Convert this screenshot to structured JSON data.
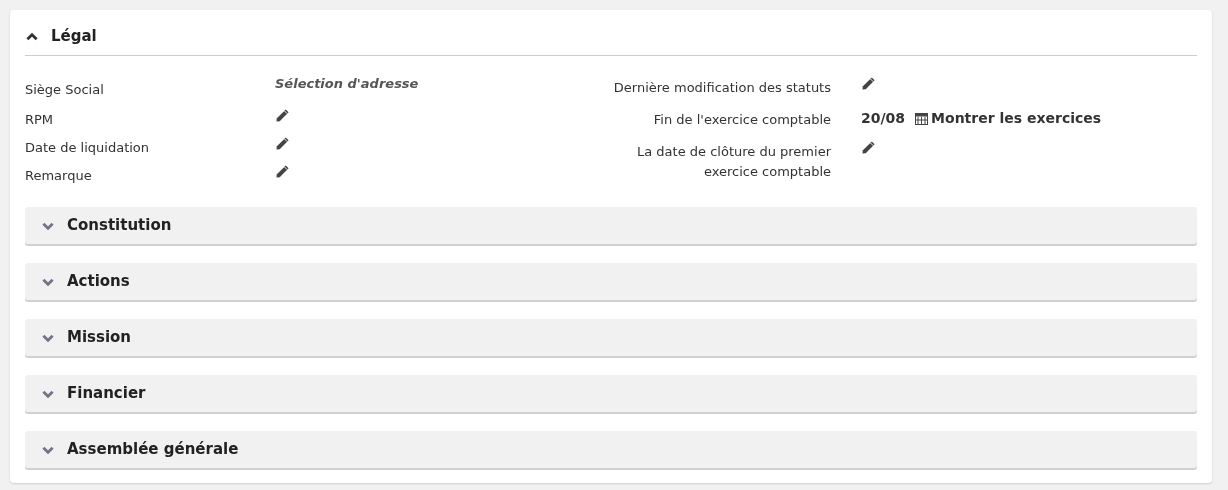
{
  "section": {
    "title": "Légal",
    "expanded": true
  },
  "left_fields": [
    {
      "label": "Siège Social",
      "kind": "link",
      "value": "Sélection d'adresse"
    },
    {
      "label": "RPM",
      "kind": "edit"
    },
    {
      "label": "Date de liquidation",
      "kind": "edit"
    },
    {
      "label": "Remarque",
      "kind": "edit"
    }
  ],
  "right_fields": [
    {
      "label": "Dernière modification des statuts",
      "kind": "edit"
    },
    {
      "label": "Fin de l'exercice comptable",
      "kind": "date",
      "value": "20/08",
      "action": "Montrer les exercices"
    },
    {
      "label": "La date de clôture du premier exercice comptable",
      "kind": "edit"
    }
  ],
  "subsections": [
    {
      "title": "Constitution",
      "expanded": false
    },
    {
      "title": "Actions",
      "expanded": false
    },
    {
      "title": "Mission",
      "expanded": false
    },
    {
      "title": "Financier",
      "expanded": false
    },
    {
      "title": "Assemblée générale",
      "expanded": false
    }
  ]
}
